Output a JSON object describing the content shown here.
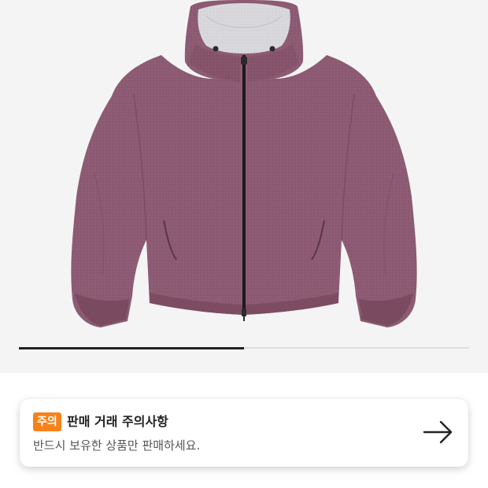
{
  "product": {
    "image_icon": "hooded-zip-jacket-image",
    "jacket_color": "#8c5a72",
    "image_progress": 0.5
  },
  "notice": {
    "badge": "주의",
    "badge_color": "#f7821b",
    "title": "판매 거래 주의사항",
    "subtitle": "반드시 보유한 상품만 판매하세요.",
    "arrow_icon": "arrow-right-icon"
  }
}
